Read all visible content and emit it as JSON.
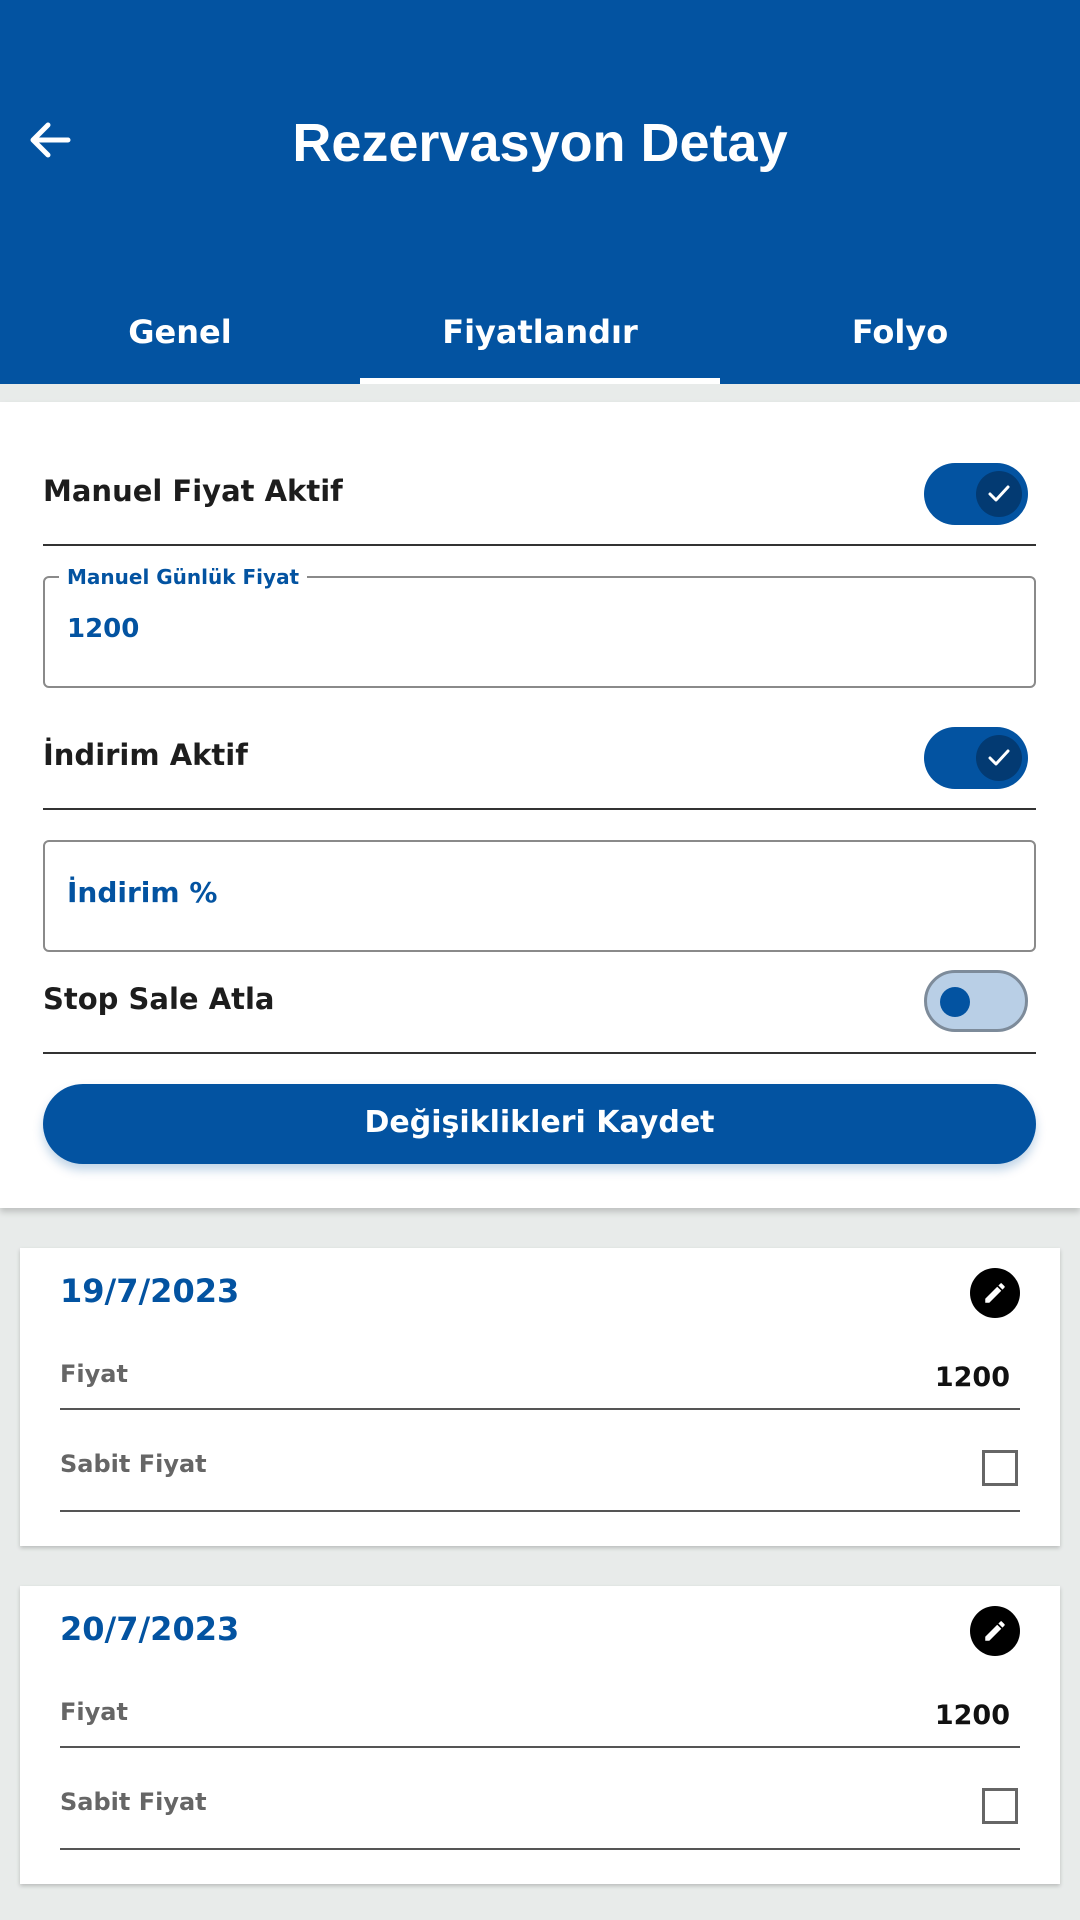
{
  "header": {
    "title": "Rezervasyon Detay",
    "back_icon": "arrow-left-icon",
    "background": "#0353a1"
  },
  "tabs": [
    {
      "label": "Genel",
      "active": false
    },
    {
      "label": "Fiyatlandır",
      "active": true
    },
    {
      "label": "Folyo",
      "active": false
    }
  ],
  "form": {
    "manual_price": {
      "label": "Manuel Fiyat Aktif",
      "enabled": true
    },
    "daily_price_field": {
      "label": "Manuel Günlük Fiyat",
      "value": "1200"
    },
    "discount": {
      "label": "İndirim Aktif",
      "enabled": true
    },
    "discount_field": {
      "placeholder": "İndirim %"
    },
    "stop_sale": {
      "label": "Stop Sale Atla",
      "enabled": false
    },
    "save_label": "Değişiklikleri Kaydet"
  },
  "days": [
    {
      "date": "19/7/2023",
      "price_label": "Fiyat",
      "price": "1200",
      "fixed_label": "Sabit Fiyat",
      "fixed": false
    },
    {
      "date": "20/7/2023",
      "price_label": "Fiyat",
      "price": "1200",
      "fixed_label": "Sabit Fiyat",
      "fixed": false
    }
  ],
  "colors": {
    "accent": "#0353a1",
    "background": "#e8ebea"
  }
}
